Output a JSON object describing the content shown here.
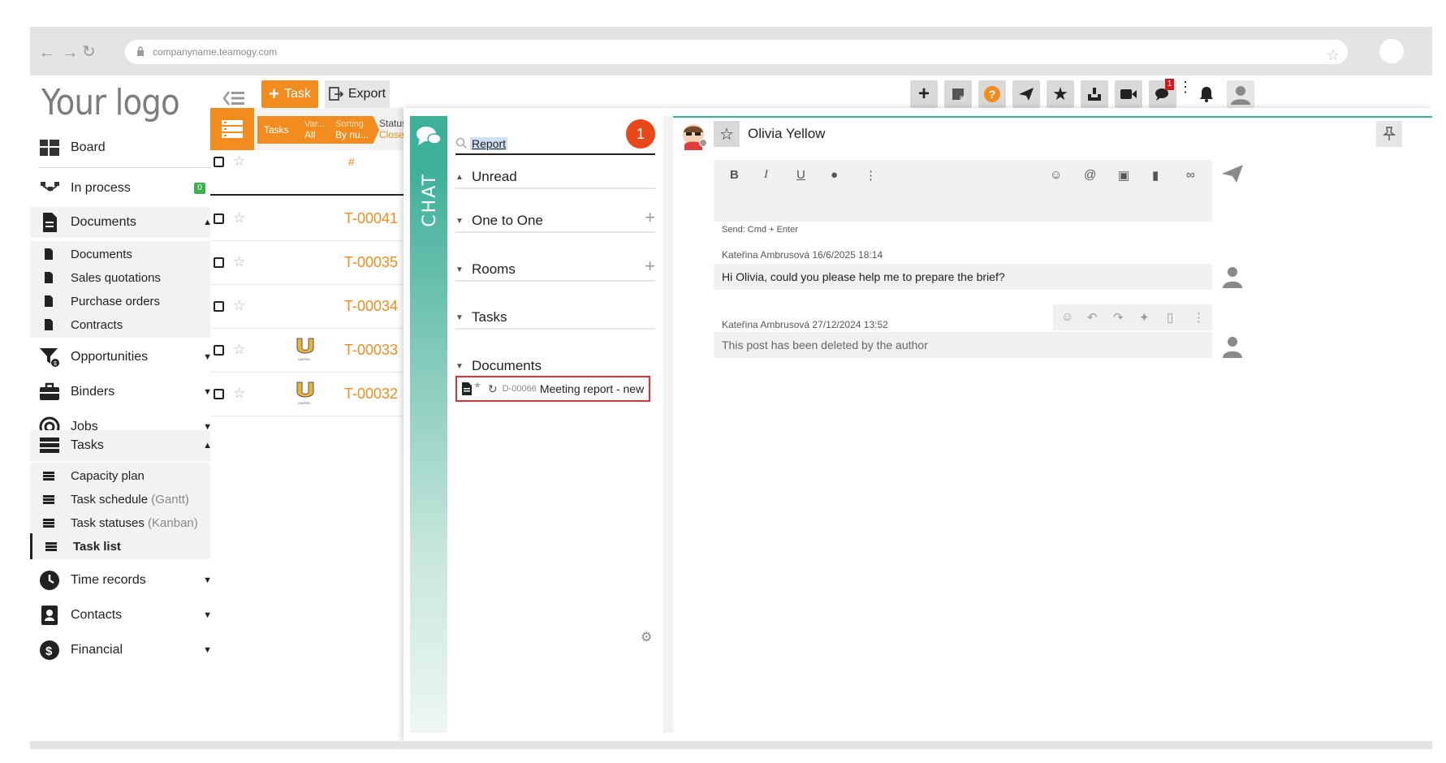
{
  "browser": {
    "url": "companyname.teamogy.com"
  },
  "app": {
    "logo": "Your logo"
  },
  "toolbar": {
    "task_label": "Task",
    "export_label": "Export",
    "icons": [
      "plus-icon",
      "notes-icon",
      "help-icon",
      "send-icon",
      "star-icon",
      "inbox-icon",
      "video-icon",
      "chat-icon",
      "more-icon",
      "bell-icon",
      "avatar-icon"
    ],
    "chat_badge": "1",
    "accent": "#f28c1e"
  },
  "sidebar": {
    "board": "Board",
    "in_process": "In process",
    "in_process_count": "0",
    "documents": "Documents",
    "documents_sub": [
      "Documents",
      "Sales quotations",
      "Purchase orders",
      "Contracts"
    ],
    "opportunities": "Opportunities",
    "binders": "Binders",
    "jobs": "Jobs",
    "tasks": "Tasks",
    "tasks_sub": {
      "capacity": "Capacity plan",
      "schedule": "Task schedule",
      "schedule_note": "(Gantt)",
      "statuses": "Task statuses",
      "statuses_note": "(Kanban)",
      "list": "Task list"
    },
    "time_records": "Time records",
    "contacts": "Contacts",
    "financial": "Financial"
  },
  "tasklist": {
    "crumb_tasks": "Tasks",
    "crumb_var_top": "Var...",
    "crumb_var_bottom": "All",
    "crumb_sort_top": "Sorting",
    "crumb_sort_bottom": "By nu...",
    "status_top": "Status",
    "status_bottom": "Closed",
    "col_number": "#",
    "rows": [
      "T-00041",
      "T-00035",
      "T-00034",
      "T-00033",
      "T-00032"
    ],
    "row_logo_text": "UNITED"
  },
  "chat": {
    "label": "CHAT",
    "search_value": "Report",
    "unread_badge": "1",
    "groups": {
      "unread": "Unread",
      "one_to_one": "One to One",
      "rooms": "Rooms",
      "tasks": "Tasks",
      "documents": "Documents"
    },
    "doc_item": {
      "id": "D-00066",
      "name": "Meeting report - new"
    },
    "status_colors": {
      "accent": "#3db09a",
      "badge": "#e8471c",
      "highlight": "#e03030"
    }
  },
  "conversation": {
    "contact_name": "Olivia Yellow",
    "send_hint": "Send: Cmd + Enter",
    "messages": [
      {
        "author_time": "Kateřina Ambrusová 16/6/2025 18:14",
        "text": "Hi Olivia, could you please help me to prepare the brief?"
      },
      {
        "author_time": "Kateřina Ambrusová 27/12/2024 13:52",
        "text": "This post has been deleted by the author"
      }
    ]
  }
}
